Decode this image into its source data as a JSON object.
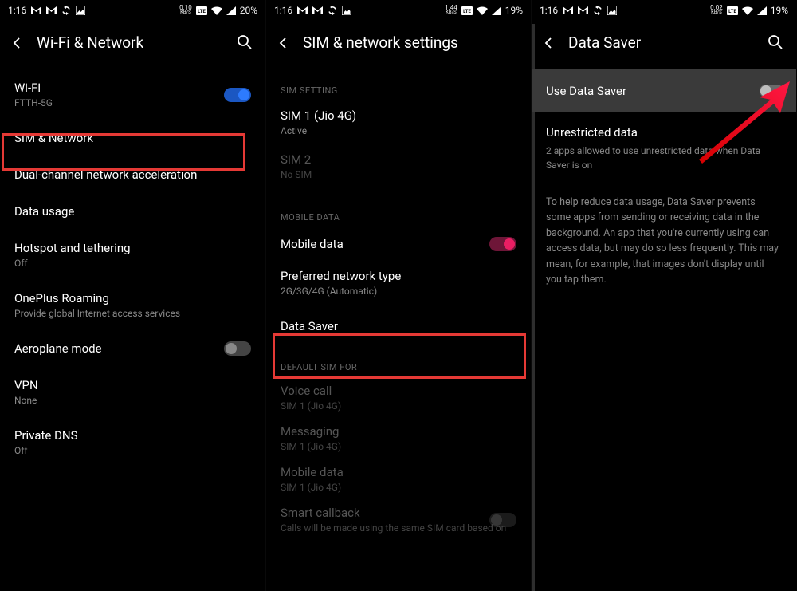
{
  "panel1": {
    "status": {
      "time": "1:16",
      "kbs_num": "0.10",
      "kbs_unit": "KB/S",
      "battery": "20%"
    },
    "header": {
      "title": "Wi-Fi & Network"
    },
    "wifi": {
      "label": "Wi-Fi",
      "sub": "FTTH-5G"
    },
    "sim": {
      "label": "SIM & Network"
    },
    "dual": {
      "label": "Dual-channel network acceleration"
    },
    "data_usage": {
      "label": "Data usage"
    },
    "hotspot": {
      "label": "Hotspot and tethering",
      "sub": "Off"
    },
    "roaming": {
      "label": "OnePlus Roaming",
      "sub": "Provide global Internet access services"
    },
    "aeroplane": {
      "label": "Aeroplane mode"
    },
    "vpn": {
      "label": "VPN",
      "sub": "None"
    },
    "pdns": {
      "label": "Private DNS",
      "sub": "Off"
    }
  },
  "panel2": {
    "status": {
      "time": "1:16",
      "kbs_num": "1.44",
      "kbs_unit": "KB/S",
      "battery": "19%"
    },
    "header": {
      "title": "SIM & network settings"
    },
    "sec_sim": "SIM SETTING",
    "sim1": {
      "label": "SIM 1 (Jio 4G)",
      "sub": "Active"
    },
    "sim2": {
      "label": "SIM 2",
      "sub": "No SIM"
    },
    "sec_mobile": "MOBILE DATA",
    "mobile_data": {
      "label": "Mobile data"
    },
    "pref": {
      "label": "Preferred network type",
      "sub": "2G/3G/4G (Automatic)"
    },
    "data_saver": {
      "label": "Data Saver"
    },
    "sec_default": "DEFAULT SIM FOR",
    "voice": {
      "label": "Voice call",
      "sub": "SIM 1 (Jio 4G)"
    },
    "msg": {
      "label": "Messaging",
      "sub": "SIM 1 (Jio 4G)"
    },
    "md": {
      "label": "Mobile data",
      "sub": "SIM 1 (Jio 4G)"
    },
    "smart": {
      "label": "Smart callback",
      "sub": "Calls will be made using the same SIM card based on"
    }
  },
  "panel3": {
    "status": {
      "time": "1:16",
      "kbs_num": "0.02",
      "kbs_unit": "KB/S",
      "battery": "19%"
    },
    "header": {
      "title": "Data Saver"
    },
    "use": {
      "label": "Use Data Saver"
    },
    "unrestricted": {
      "label": "Unrestricted data",
      "sub": "2 apps allowed to use unrestricted data when Data Saver is on"
    },
    "body": "To help reduce data usage, Data Saver prevents some apps from sending or receiving data in the background. An app that you're currently using can access data, but may do so less frequently. This may mean, for example, that images don't display until you tap them."
  }
}
